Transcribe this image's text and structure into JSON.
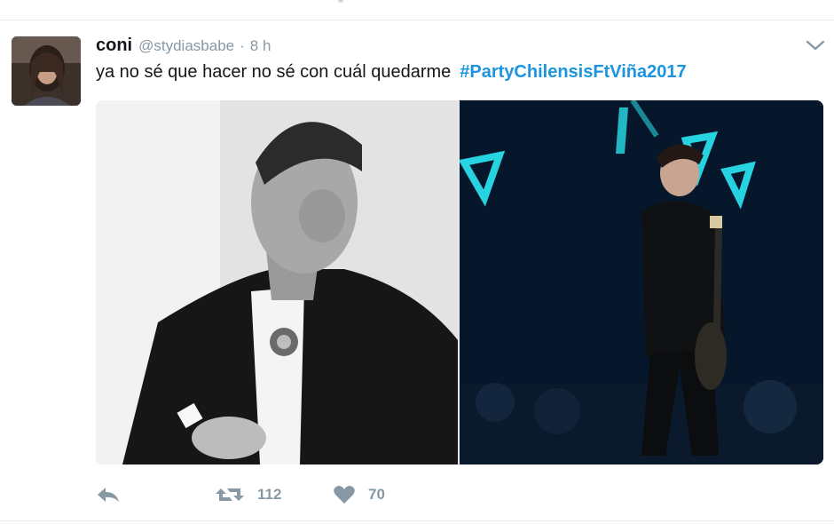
{
  "tweet": {
    "author": {
      "name": "coni",
      "handle": "@stydiasbabe",
      "separator": "·",
      "time": "8 h"
    },
    "text": "ya no sé que hacer no sé con cuál quedarme",
    "hashtag": "#PartyChilensisFtViña2017",
    "actions": {
      "reply_icon": "reply-icon",
      "retweet_icon": "retweet-icon",
      "retweet_count": "112",
      "like_icon": "heart-icon",
      "like_count": "70"
    },
    "menu_icon": "chevron-down-icon"
  },
  "colors": {
    "text": "#14171a",
    "secondary": "#8899a6",
    "link": "#1b95e0",
    "divider": "#e6ecf0"
  }
}
